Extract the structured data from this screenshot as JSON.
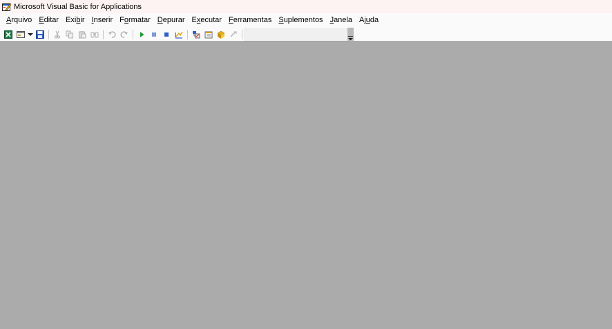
{
  "window": {
    "title": "Microsoft Visual Basic for Applications",
    "icon": "vba-app-icon"
  },
  "menubar": {
    "items": [
      {
        "pre": "",
        "key": "A",
        "post": "rquivo"
      },
      {
        "pre": "",
        "key": "E",
        "post": "ditar"
      },
      {
        "pre": "Exi",
        "key": "b",
        "post": "ir"
      },
      {
        "pre": "",
        "key": "I",
        "post": "nserir"
      },
      {
        "pre": "F",
        "key": "o",
        "post": "rmatar"
      },
      {
        "pre": "",
        "key": "D",
        "post": "epurar"
      },
      {
        "pre": "E",
        "key": "x",
        "post": "ecutar"
      },
      {
        "pre": "",
        "key": "F",
        "post": "erramentas"
      },
      {
        "pre": "",
        "key": "S",
        "post": "uplementos"
      },
      {
        "pre": "",
        "key": "J",
        "post": "anela"
      },
      {
        "pre": "Aj",
        "key": "u",
        "post": "da"
      }
    ]
  },
  "toolbar": {
    "buttons": [
      "excel-icon",
      "insert-userform-icon",
      "dropdown-arrow-icon",
      "save-icon",
      "cut-icon",
      "copy-icon",
      "paste-icon",
      "find-icon",
      "undo-icon",
      "redo-icon",
      "run-icon",
      "break-icon",
      "reset-icon",
      "design-mode-icon",
      "project-explorer-icon",
      "properties-icon",
      "object-browser-icon",
      "toolbox-icon",
      "help-icon"
    ],
    "position_text": ""
  },
  "colors": {
    "titlebar": "#fdf3f3",
    "bar": "#fafafa",
    "workspace": "#ababab",
    "run": "#1a9b2f",
    "stop": "#2d5fc8",
    "help": "#2f6fd8",
    "excel": "#1e7b45"
  }
}
